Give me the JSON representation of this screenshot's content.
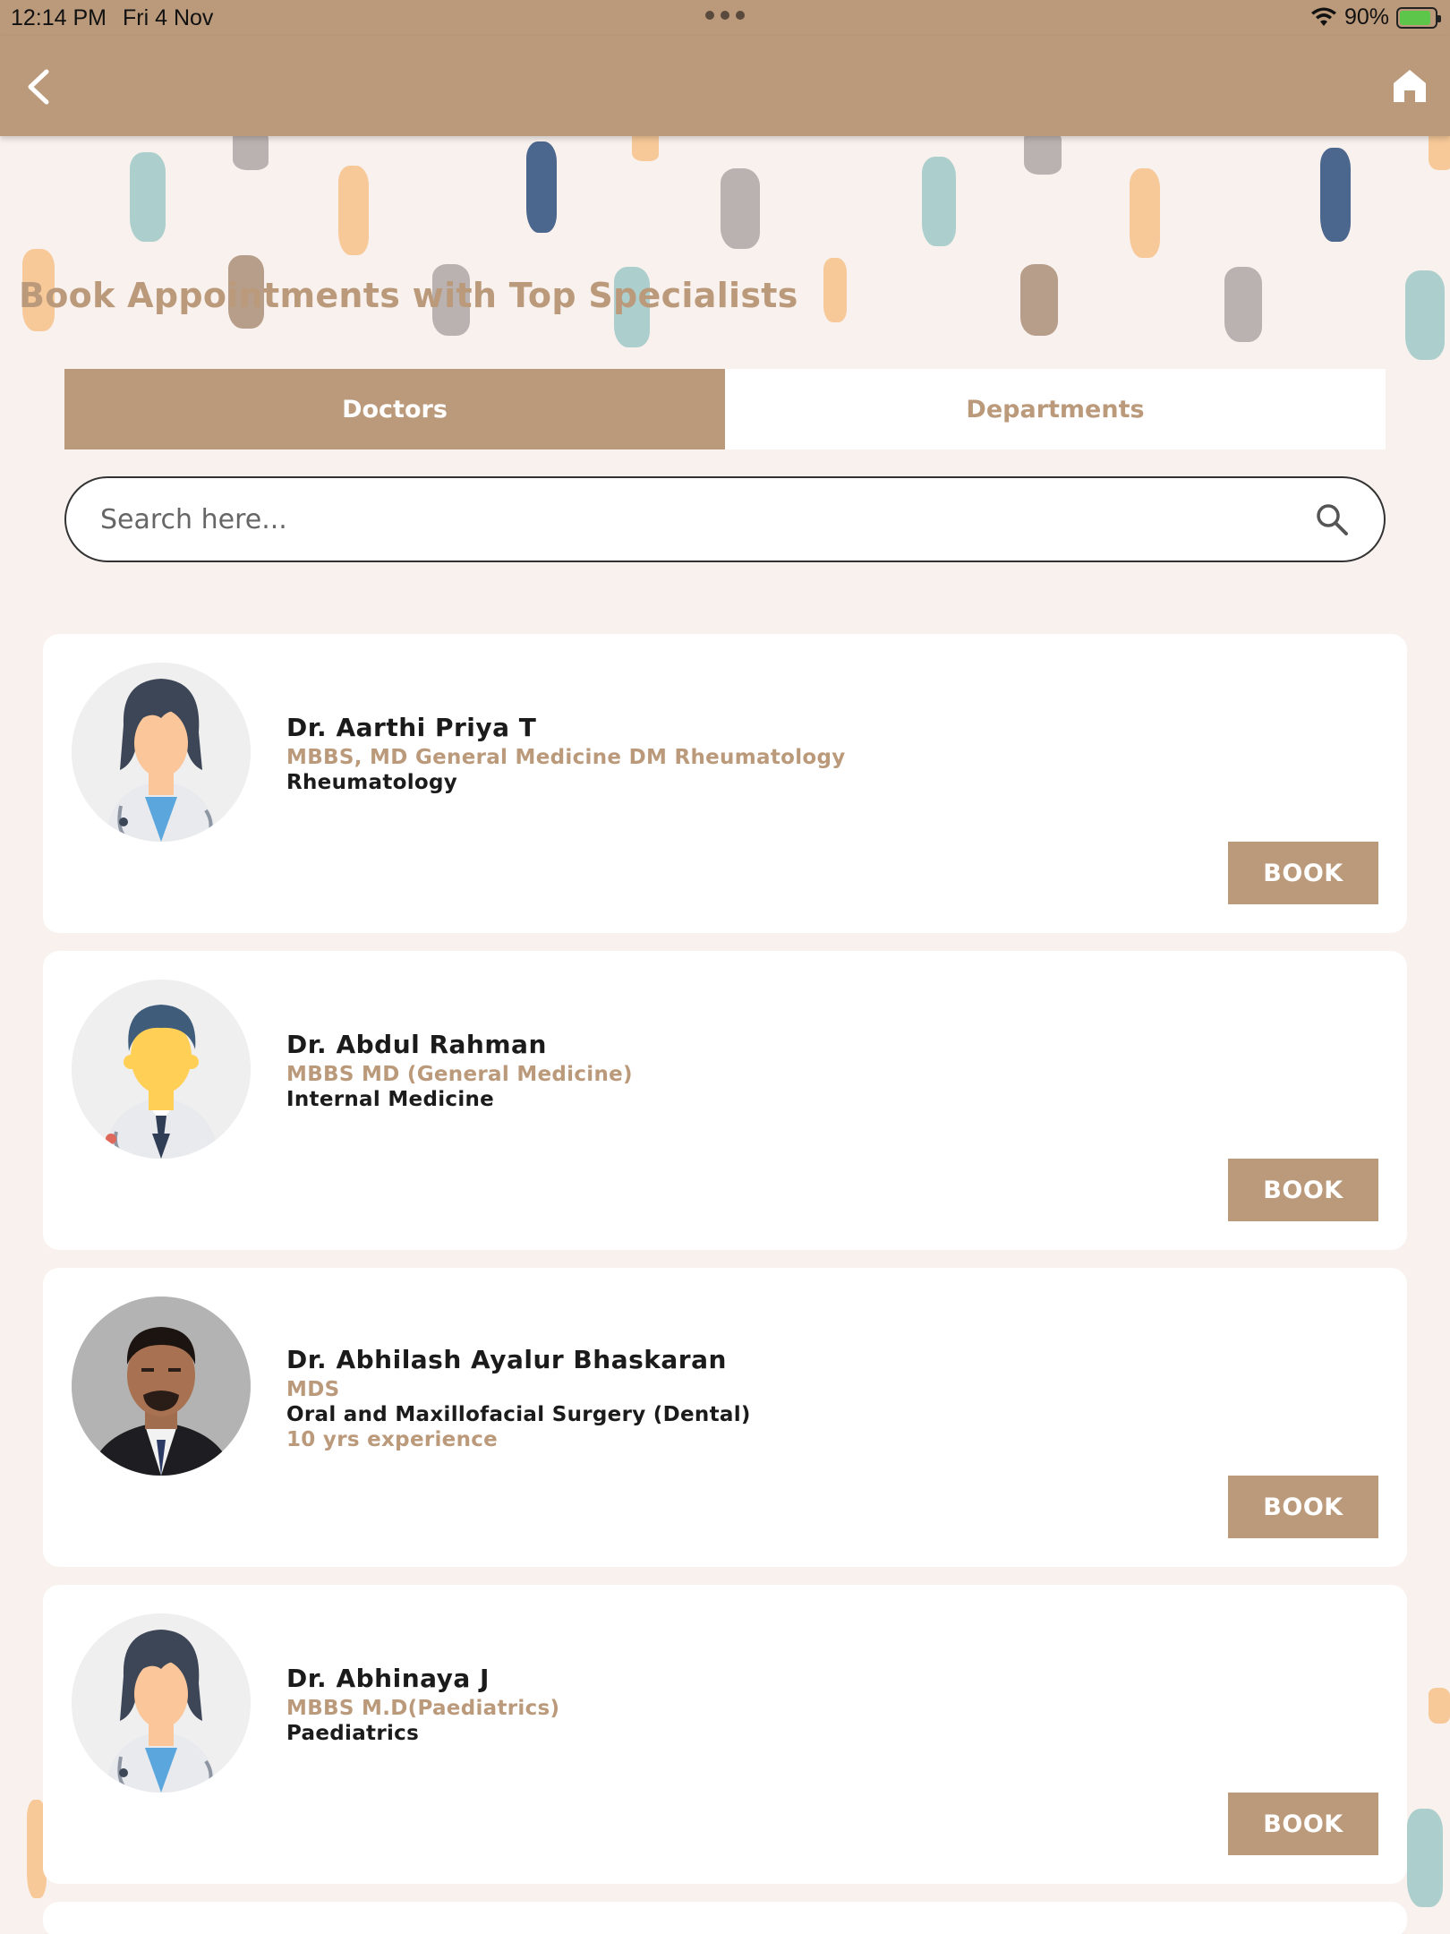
{
  "status_bar": {
    "time": "12:14 PM",
    "date": "Fri 4 Nov",
    "battery": "90%",
    "battery_level": 0.9,
    "icons": [
      "wifi-icon",
      "battery-charging-icon"
    ]
  },
  "app_bar": {
    "icons": [
      "back-chevron-icon",
      "home-icon"
    ]
  },
  "page": {
    "title": "Book Appointments with Top Specialists"
  },
  "tabs": [
    {
      "label": "Doctors",
      "active": true
    },
    {
      "label": "Departments",
      "active": false
    }
  ],
  "search": {
    "placeholder": "Search here...",
    "icon": "search-icon"
  },
  "doctors": [
    {
      "name": "Dr. Aarthi Priya T",
      "qualification": "MBBS, MD General Medicine DM Rheumatology",
      "department": "Rheumatology",
      "experience": "",
      "avatar": "female-doctor-avatar",
      "book_label": "BOOK"
    },
    {
      "name": "Dr. Abdul Rahman",
      "qualification": "MBBS MD (General Medicine)",
      "department": "Internal Medicine",
      "experience": "",
      "avatar": "male-doctor-avatar",
      "book_label": "BOOK"
    },
    {
      "name": "Dr. Abhilash Ayalur Bhaskaran",
      "qualification": "MDS",
      "department": "Oral and Maxillofacial Surgery (Dental)",
      "experience": "10 yrs experience",
      "avatar": "doctor-photo",
      "book_label": "BOOK"
    },
    {
      "name": "Dr. Abhinaya J",
      "qualification": "MBBS M.D(Paediatrics)",
      "department": "Paediatrics",
      "experience": "",
      "avatar": "female-doctor-avatar",
      "book_label": "BOOK"
    }
  ],
  "colors": {
    "brand": "#bb9a7b",
    "background": "#f8f1ed",
    "card": "#ffffff",
    "text": "#1b1b1b"
  }
}
